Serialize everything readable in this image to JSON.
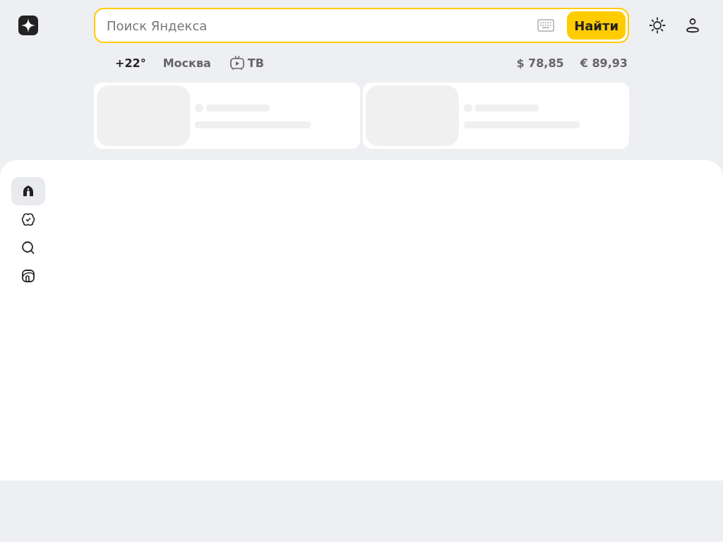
{
  "search": {
    "placeholder": "Поиск Яндекса",
    "button": "Найти"
  },
  "info": {
    "weather": "+22°",
    "city": "Москва",
    "tv": "ТВ"
  },
  "rates": [
    "$ 78,85",
    "€ 89,93"
  ],
  "skeleton_cards": [
    {
      "kind": "loading"
    },
    {
      "kind": "loading"
    }
  ],
  "sidebar": [
    {
      "kind": "home",
      "selected": true
    },
    {
      "kind": "services",
      "selected": false
    },
    {
      "kind": "search",
      "selected": false
    },
    {
      "kind": "apps",
      "selected": false
    }
  ]
}
